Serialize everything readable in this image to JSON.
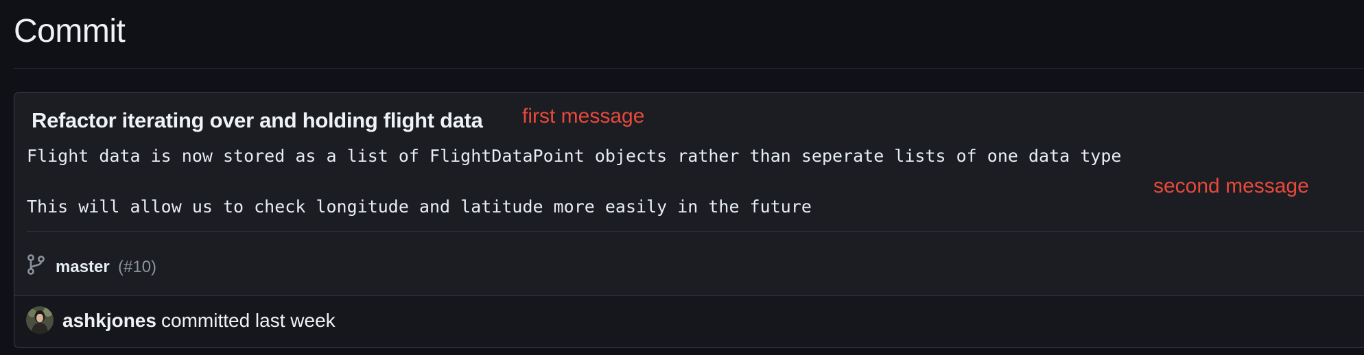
{
  "page": {
    "title": "Commit"
  },
  "commit": {
    "title": "Refactor iterating over and holding flight data",
    "body_lines": [
      "Flight data is now stored as a list of FlightDataPoint objects rather than seperate lists of one data type",
      "This will allow us to check longitude and latitude more easily in the future"
    ],
    "branch": {
      "name": "master",
      "pr": "(#10)",
      "icon": "git-branch-icon"
    },
    "author": {
      "username": "ashkjones",
      "action": "committed last week"
    }
  },
  "annotations": {
    "first": "first message",
    "second": "second message"
  },
  "colors": {
    "background": "#0f1116",
    "card": "#1b1d23",
    "annotation": "#e8493a",
    "muted": "#8b949e"
  }
}
